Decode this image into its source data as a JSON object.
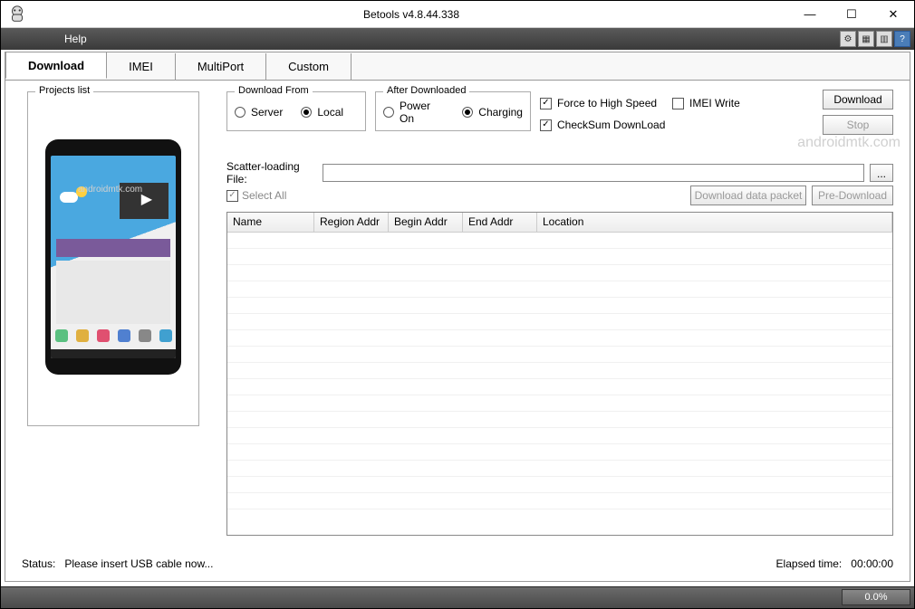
{
  "window": {
    "title": "Betools v4.8.44.338"
  },
  "menu": {
    "help": "Help"
  },
  "tabs": [
    "Download",
    "IMEI",
    "MultiPort",
    "Custom"
  ],
  "active_tab": 0,
  "projects_legend": "Projects list",
  "download_from": {
    "legend": "Download From",
    "server": "Server",
    "local": "Local",
    "selected": "local"
  },
  "after_downloaded": {
    "legend": "After Downloaded",
    "power_on": "Power On",
    "charging": "Charging",
    "selected": "charging"
  },
  "checks": {
    "force_high_speed": "Force to High Speed",
    "checksum": "CheckSum DownLoad",
    "imei_write": "IMEI Write",
    "force_checked": true,
    "checksum_checked": true,
    "imei_checked": false
  },
  "buttons": {
    "download": "Download",
    "stop": "Stop",
    "download_data_packet": "Download data packet",
    "pre_download": "Pre-Download",
    "browse": "..."
  },
  "scatter": {
    "label": "Scatter-loading File:",
    "value": ""
  },
  "select_all": {
    "label": "Select All",
    "checked": true
  },
  "table": {
    "columns": [
      "Name",
      "Region Addr",
      "Begin Addr",
      "End Addr",
      "Location"
    ],
    "rows": []
  },
  "status": {
    "label": "Status:",
    "text": "Please insert USB cable now...",
    "elapsed_label": "Elapsed time:",
    "elapsed": "00:00:00"
  },
  "progress_pct": "0.0%",
  "watermark": "androidmtk.com"
}
